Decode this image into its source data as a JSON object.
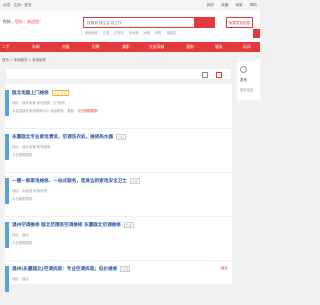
{
  "topbar": {
    "left": "欢迎 · 注册 · 登录",
    "right_items": [
      "我的",
      "收藏",
      "商家",
      "帮助"
    ]
  },
  "header": {
    "welcome_prefix": "你好，",
    "welcome_highlight": "您好，欢迎您！",
    "search_placeholder": "找服务 找生活 找工作",
    "hotwords": [
      "家电维修",
      "空调",
      "洗衣机",
      "热水器",
      "冰箱",
      "电视",
      "油烟机"
    ],
    "post_label": "免费发布信息"
  },
  "nav": [
    "二手",
    "车辆",
    "房屋",
    "招聘",
    "兼职",
    "交友同城",
    "宠物",
    "服务",
    "培训"
  ],
  "breadcrumb": "首页 > 本地服务 > 家电维修",
  "toolbar": {
    "sort_options": [
      "默认",
      "最新",
      "价格"
    ]
  },
  "colors": {
    "accent": "#e4393c",
    "link": "#2a57a7"
  },
  "sidebar": {
    "line1": "发布",
    "line2": "服务信息"
  },
  "listings": [
    {
      "title": "瓯北电器上门维修",
      "tag": "认证 置顶",
      "meta1": "地区：瓯北街道 家电维修 上门服务",
      "meta2": "永嘉县瓯北家电维修中心 电话联系 · 更新：",
      "meta2_highlight": "今日刚刚更新",
      "price": ""
    },
    {
      "title": "永嘉瓯北专业家电清洗，空调洗衣机，维修热水器",
      "tag": "认证",
      "meta1": "地区：瓯北街道 家电维修",
      "meta2": "今日刚刚更新",
      "meta2_highlight": "",
      "price": ""
    },
    {
      "title": "一键一家家电维修，一站式服务，您身边的家电安全卫士",
      "tag": "认证",
      "meta1": "地区：永嘉县 家电维修",
      "meta2": "今日刚刚更新",
      "meta2_highlight": "",
      "price": ""
    },
    {
      "title": "温州空调维修 瓯北范围洗空调维修 永嘉瓯北空调维修",
      "tag": "认证",
      "meta1": "地区：瓯北",
      "meta2": "今日刚刚更新",
      "meta2_highlight": "",
      "price": ""
    },
    {
      "title": "温州(永嘉瓯北)空调拆装：专业空调拆装；低价维修",
      "tag": "认证",
      "meta1": "地区：瓯北",
      "meta2": "",
      "meta2_highlight": "",
      "price": "面议"
    }
  ]
}
